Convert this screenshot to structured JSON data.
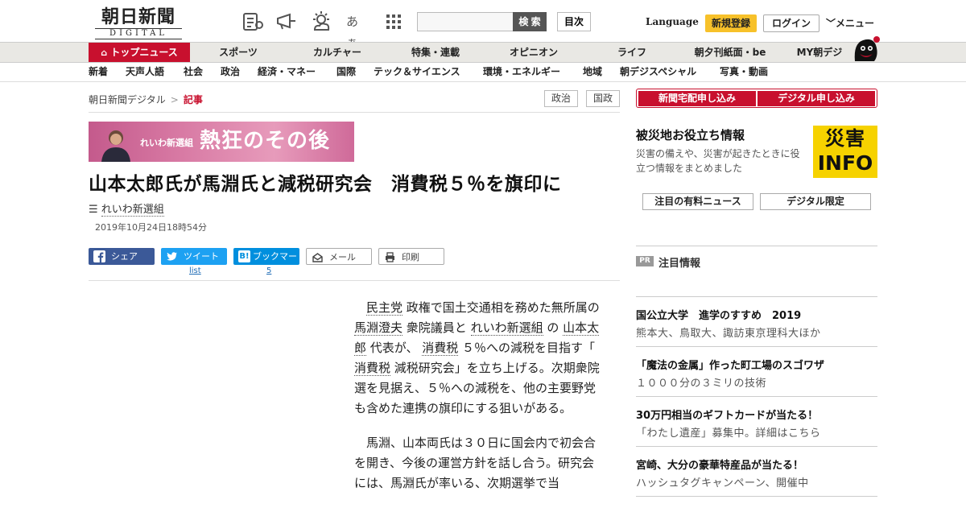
{
  "header": {
    "logo_main": "朝日新聞",
    "logo_sub": "DIGITAL",
    "search_button": "検 索",
    "toc_button": "目次",
    "language": "Language",
    "register": "新規登録",
    "login": "ログイン",
    "menu": "メニュー",
    "kana_icon_text": "あぁ"
  },
  "nav_primary": [
    {
      "label": "トップニュース",
      "active": true
    },
    {
      "label": "スポーツ"
    },
    {
      "label": "カルチャー"
    },
    {
      "label": "特集・連載"
    },
    {
      "label": "オピニオン"
    },
    {
      "label": "ライフ"
    },
    {
      "label": "朝夕刊紙面・be"
    },
    {
      "label": "MY朝デジ"
    }
  ],
  "nav_secondary": [
    "新着",
    "天声人語",
    "社会",
    "政治",
    "経済・マネー",
    "国際",
    "テック＆サイエンス",
    "環境・エネルギー",
    "地域",
    "朝デジスペシャル",
    "写真・動画"
  ],
  "breadcrumb": {
    "home": "朝日新聞デジタル",
    "sep": ">",
    "current": "記事"
  },
  "tags": [
    "政治",
    "国政"
  ],
  "banner": {
    "small": "れいわ新選組",
    "big": "熱狂のその後"
  },
  "article": {
    "headline": "山本太郎氏が馬淵氏と減税研究会　消費税５％を旗印に",
    "topic": "れいわ新選組",
    "date": "2019年10月24日18時54分",
    "share": {
      "facebook": "シェア",
      "twitter": "ツイート",
      "hatena": "ブックマーク",
      "mail": "メール",
      "print": "印刷",
      "twitter_count": "list",
      "hatena_count": "5"
    },
    "p1": {
      "k1": "民主党",
      "t1": " 政権で国土交通相を務めた無所属の ",
      "k2": "馬淵澄夫",
      "t2": " 衆院議員と ",
      "k3": "れいわ新選組",
      "t3": " の ",
      "k4": "山本太郎",
      "t4": " 代表が、 ",
      "k5": "消費税",
      "t5": " ５％への減税を目指す「 ",
      "k6": "消費税",
      "t6": " 減税研究会」を立ち上げる。次期衆院選を見据え、５％への減税を、他の主要野党も含めた連携の旗印にする狙いがある。"
    },
    "p2": "馬淵、山本両氏は３０日に国会内で初会合を開き、今後の運営方針を話し合う。研究会には、馬淵氏が率いる、次期選挙で当"
  },
  "sidebar": {
    "btn_newspaper": "新聞宅配申し込み",
    "btn_digital": "デジタル申し込み",
    "disaster_title": "被災地お役立ち情報",
    "disaster_desc": "災害の備えや、災害が起きたときに役立つ情報をまとめました",
    "disaster_logo_top": "災害",
    "disaster_logo_bottom": "INFO",
    "pill_paid": "注目の有料ニュース",
    "pill_digital": "デジタル限定",
    "pr_badge": "PR",
    "pr_label": "注目情報",
    "promos": [
      {
        "title": "国公立大学　進学のすすめ　2019",
        "sub": "熊本大、鳥取大、諏訪東京理科大ほか"
      },
      {
        "title": "「魔法の金属」作った町工場のスゴワザ",
        "sub": "１０００分の３ミリの技術"
      },
      {
        "title": "30万円相当のギフトカードが当たる！",
        "sub": "「わたし遺産」募集中。詳細はこちら"
      },
      {
        "title": "宮崎、大分の豪華特産品が当たる！",
        "sub": "ハッシュタグキャンペーン、開催中"
      }
    ]
  },
  "colors": {
    "brand_red": "#c8102e",
    "register_yellow": "#f7c12a",
    "facebook": "#3b5998",
    "twitter": "#1da1f2",
    "hatena": "#008fde"
  }
}
